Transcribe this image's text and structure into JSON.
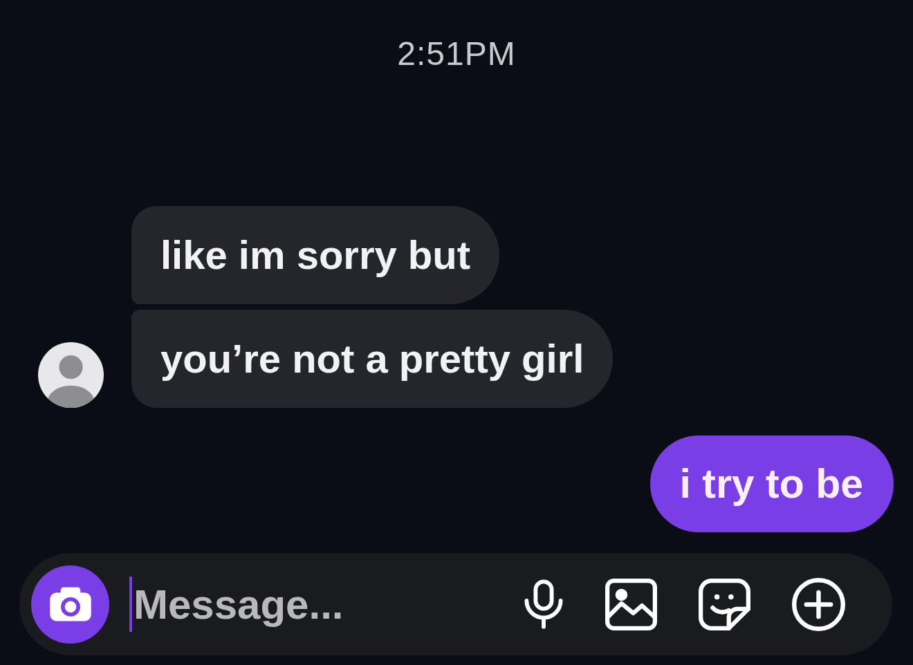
{
  "timestamp": "2:51PM",
  "messages": [
    {
      "kind": "received",
      "text": "like im sorry but",
      "avatar": false
    },
    {
      "kind": "received",
      "text": "you’re not a pretty girl",
      "avatar": true
    },
    {
      "kind": "sent",
      "text": "i try to be"
    }
  ],
  "composer": {
    "placeholder": "Message...",
    "focused": true
  }
}
